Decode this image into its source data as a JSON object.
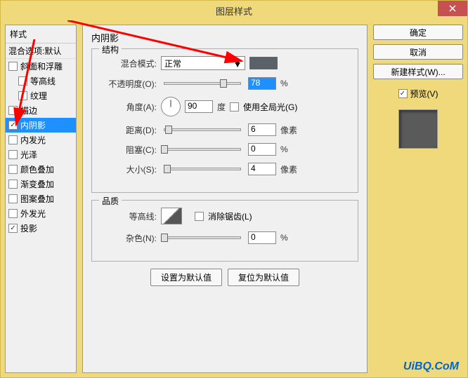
{
  "title": "图层样式",
  "left": {
    "header": "样式",
    "blend": "混合选项:默认",
    "items": [
      {
        "label": "斜面和浮雕",
        "checked": false,
        "indent": false
      },
      {
        "label": "等高线",
        "checked": false,
        "indent": true
      },
      {
        "label": "纹理",
        "checked": false,
        "indent": true
      },
      {
        "label": "描边",
        "checked": false,
        "indent": false
      },
      {
        "label": "内阴影",
        "checked": true,
        "indent": false,
        "selected": true
      },
      {
        "label": "内发光",
        "checked": false,
        "indent": false
      },
      {
        "label": "光泽",
        "checked": false,
        "indent": false
      },
      {
        "label": "颜色叠加",
        "checked": false,
        "indent": false
      },
      {
        "label": "渐变叠加",
        "checked": false,
        "indent": false
      },
      {
        "label": "图案叠加",
        "checked": false,
        "indent": false
      },
      {
        "label": "外发光",
        "checked": false,
        "indent": false
      },
      {
        "label": "投影",
        "checked": true,
        "indent": false
      }
    ]
  },
  "center": {
    "title": "内阴影",
    "struct_legend": "结构",
    "blend_mode_label": "混合模式:",
    "blend_mode_value": "正常",
    "color": "#5a6168",
    "opacity_label": "不透明度(O):",
    "opacity_value": "78",
    "opacity_unit": "%",
    "angle_label": "角度(A):",
    "angle_value": "90",
    "angle_unit": "度",
    "global_light_label": "使用全局光(G)",
    "global_light_checked": false,
    "distance_label": "距离(D):",
    "distance_value": "6",
    "distance_unit": "像素",
    "choke_label": "阻塞(C):",
    "choke_value": "0",
    "choke_unit": "%",
    "size_label": "大小(S):",
    "size_value": "4",
    "size_unit": "像素",
    "quality_legend": "品质",
    "contour_label": "等高线:",
    "antialias_label": "消除锯齿(L)",
    "antialias_checked": false,
    "noise_label": "杂色(N):",
    "noise_value": "0",
    "noise_unit": "%",
    "default_btn": "设置为默认值",
    "reset_btn": "复位为默认值"
  },
  "right": {
    "ok": "确定",
    "cancel": "取消",
    "new_style": "新建样式(W)...",
    "preview_label": "预览(V)",
    "preview_checked": true
  },
  "watermark": "UiBQ.CoM"
}
